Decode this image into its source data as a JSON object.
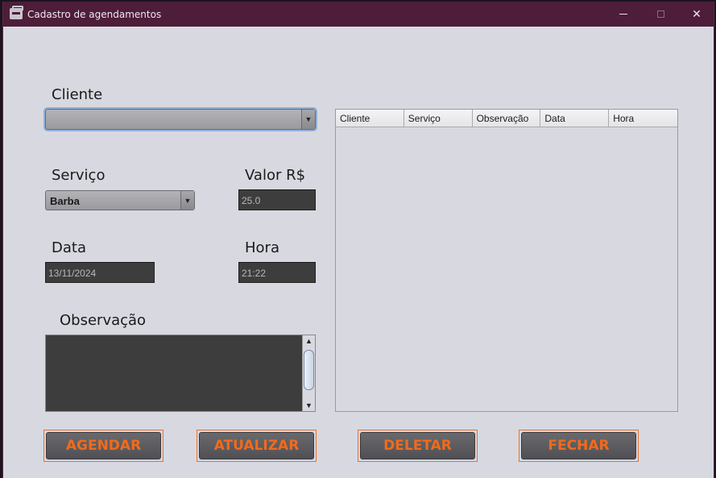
{
  "window": {
    "title": "Cadastro de agendamentos",
    "minimize_icon": "minimize-icon",
    "maximize_icon": "maximize-icon",
    "close_icon": "close-icon",
    "close_glyph": "✕"
  },
  "form": {
    "cliente_label": "Cliente",
    "cliente_value": "",
    "servico_label": "Serviço",
    "servico_value": "Barba",
    "valor_label": "Valor R$",
    "valor_value": "25.0",
    "data_label": "Data",
    "data_value": "13/11/2024",
    "hora_label": "Hora",
    "hora_value": "21:22",
    "observacao_label": "Observação",
    "observacao_value": ""
  },
  "table": {
    "columns": [
      "Cliente",
      "Serviço",
      "Observação",
      "Data",
      "Hora"
    ],
    "rows": []
  },
  "buttons": {
    "agendar": "AGENDAR",
    "atualizar": "ATUALIZAR",
    "deletar": "DELETAR",
    "fechar": "FECHAR"
  },
  "colors": {
    "titlebar": "#4d1d3a",
    "button_text": "#f26a1b",
    "field_bg": "#3d3d3d"
  }
}
